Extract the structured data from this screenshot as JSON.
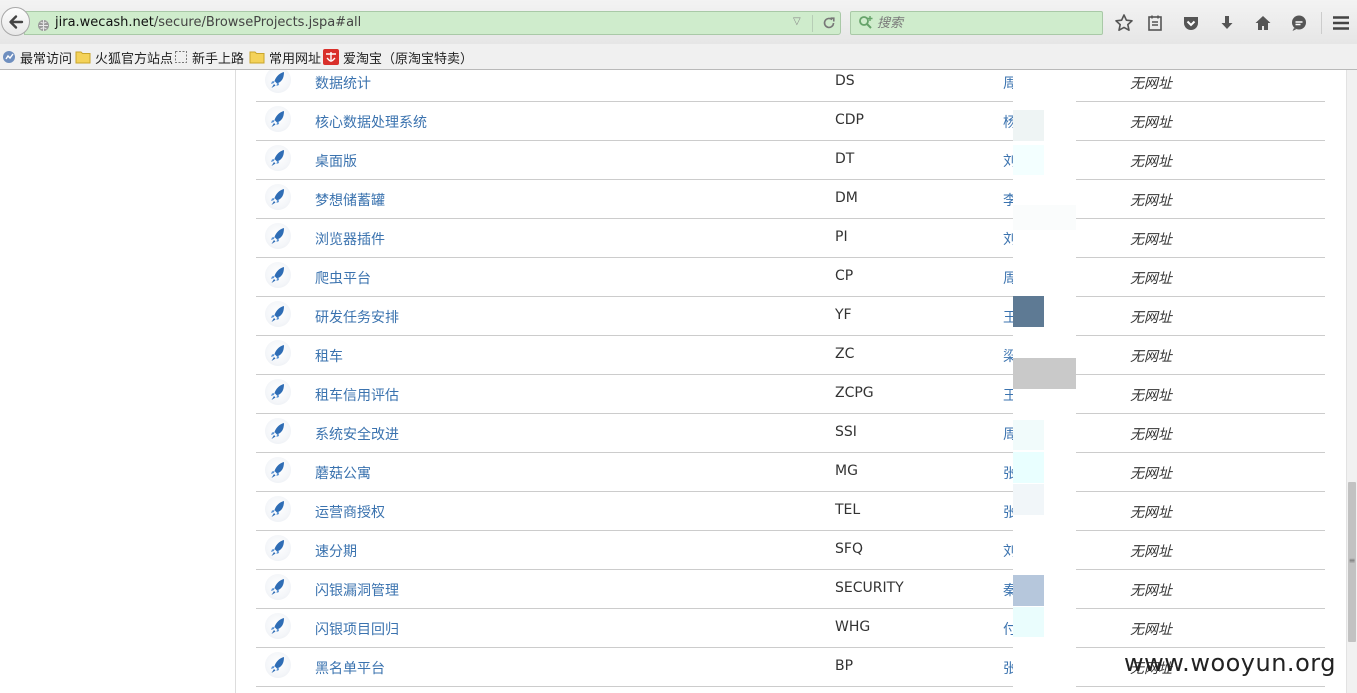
{
  "browser": {
    "url_host": "jira.wecash.net",
    "url_path": "/secure/BrowseProjects.jspa#all",
    "search_placeholder": "搜索",
    "bookmarks": [
      "最常访问",
      "火狐官方站点",
      "新手上路",
      "常用网址",
      "爱淘宝（原淘宝特卖）"
    ],
    "colors": {
      "urlbar_bg": "#cfeccc",
      "link": "#3b73af"
    }
  },
  "projects": [
    {
      "name": "数据统计",
      "key": "DS",
      "lead": "周",
      "url": "无网址"
    },
    {
      "name": "核心数据处理系统",
      "key": "CDP",
      "lead": "杨",
      "url": "无网址"
    },
    {
      "name": "桌面版",
      "key": "DT",
      "lead": "刘",
      "url": "无网址"
    },
    {
      "name": "梦想储蓄罐",
      "key": "DM",
      "lead": "李",
      "url": "无网址"
    },
    {
      "name": "浏览器插件",
      "key": "PI",
      "lead": "刘",
      "url": "无网址"
    },
    {
      "name": "爬虫平台",
      "key": "CP",
      "lead": "周",
      "url": "无网址"
    },
    {
      "name": "研发任务安排",
      "key": "YF",
      "lead": "王",
      "url": "无网址"
    },
    {
      "name": "租车",
      "key": "ZC",
      "lead": "梁",
      "url": "无网址"
    },
    {
      "name": "租车信用评估",
      "key": "ZCPG",
      "lead": "王",
      "url": "无网址"
    },
    {
      "name": "系统安全改进",
      "key": "SSI",
      "lead": "周",
      "url": "无网址"
    },
    {
      "name": "蘑菇公寓",
      "key": "MG",
      "lead": "张",
      "url": "无网址"
    },
    {
      "name": "运营商授权",
      "key": "TEL",
      "lead": "张",
      "url": "无网址"
    },
    {
      "name": "速分期",
      "key": "SFQ",
      "lead": "刘",
      "url": "无网址"
    },
    {
      "name": "闪银漏洞管理",
      "key": "SECURITY",
      "lead": "秦",
      "url": "无网址"
    },
    {
      "name": "闪银项目回归",
      "key": "WHG",
      "lead": "付",
      "url": "无网址"
    },
    {
      "name": "黑名单平台",
      "key": "BP",
      "lead": "张",
      "url": "无网址"
    }
  ],
  "watermark": "www.wooyun.org"
}
